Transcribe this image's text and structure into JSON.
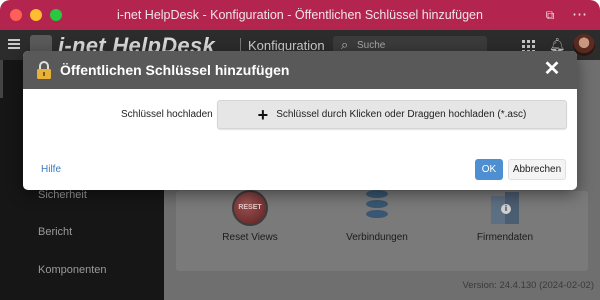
{
  "window": {
    "title": "i-net HelpDesk - Konfiguration - Öffentlichen Schlüssel hinzufügen"
  },
  "header": {
    "logo_text": "i-net HelpDesk",
    "section": "Konfiguration",
    "search_placeholder": "Suche"
  },
  "sidebar": {
    "items": [
      {
        "label": "Sicherheit"
      },
      {
        "label": "Bericht"
      },
      {
        "label": "Komponenten"
      }
    ]
  },
  "main": {
    "tiles": [
      {
        "label": "Reset Views",
        "icon": "reset-icon",
        "badge": "RESET"
      },
      {
        "label": "Verbindungen",
        "icon": "database-icon"
      },
      {
        "label": "Firmendaten",
        "icon": "building-info-icon",
        "badge": "i"
      }
    ],
    "version": "Version: 24.4.130 (2024-02-02)"
  },
  "dialog": {
    "title": "Öffentlichen Schlüssel hinzufügen",
    "upload_label": "Schlüssel hochladen",
    "upload_button": "Schlüssel durch Klicken oder Draggen hochladen (*.asc)",
    "help": "Hilfe",
    "ok": "OK",
    "cancel": "Abbrechen"
  },
  "colors": {
    "titlebar": "#b3244e",
    "dialog_header": "#595959",
    "primary_button": "#4d8fd0",
    "link": "#3a7bbf"
  }
}
